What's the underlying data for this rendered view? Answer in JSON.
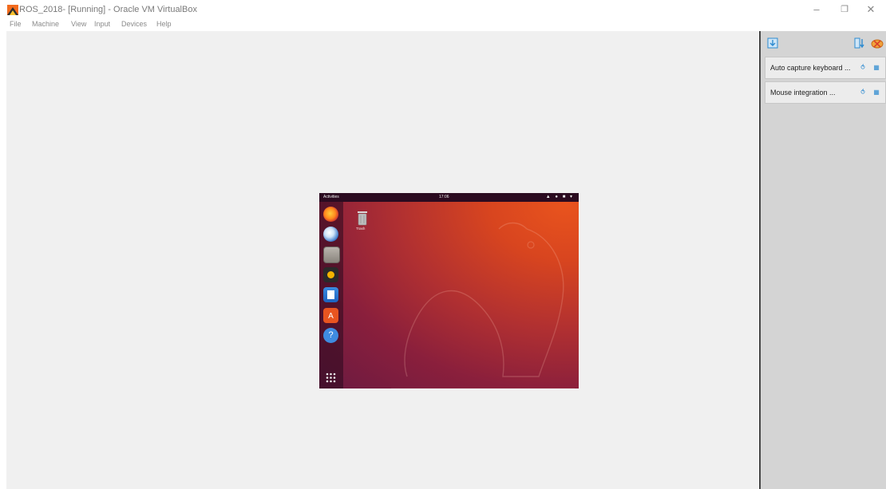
{
  "window": {
    "title": "ROS_2018- [Running] - Oracle VM VirtualBox",
    "minimize": "–",
    "restore": "❐",
    "close": "✕"
  },
  "menu": [
    "File",
    "Machine",
    "View",
    "Input",
    "Devices",
    "Help"
  ],
  "vm": {
    "activities": "Activities",
    "clock": "17:06",
    "trash_label": "Trash",
    "dock_icons": [
      "firefox-icon",
      "thunderbird-icon",
      "files-icon",
      "rhythmbox-icon",
      "writer-icon",
      "software-center-icon",
      "help-icon",
      "show-apps-icon"
    ]
  },
  "side_panel": {
    "items": [
      {
        "label": "Auto capture keyboard ...",
        "icons": [
          "settings-icon",
          "pin-icon"
        ]
      },
      {
        "label": "Mouse integration ...",
        "icons": [
          "settings-icon",
          "pin-icon"
        ]
      }
    ]
  },
  "colors": {
    "ubuntu_orange": "#e9541e",
    "ubuntu_purple": "#6a1a41",
    "panel_bg": "#d4d4d4",
    "main_bg": "#f0f0f0"
  }
}
